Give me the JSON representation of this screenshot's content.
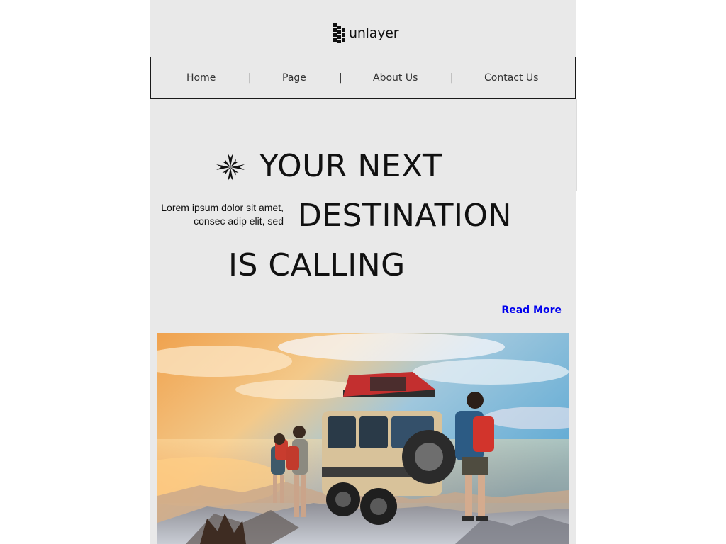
{
  "brand": {
    "name": "unlayer"
  },
  "nav": {
    "items": [
      {
        "label": "Home"
      },
      {
        "label": "Page"
      },
      {
        "label": "About Us"
      },
      {
        "label": "Contact Us"
      }
    ],
    "separator": "|"
  },
  "hero": {
    "line1": "YOUR NEXT",
    "line2": "DESTINATION",
    "line3": "IS CALLING",
    "side_text": "Lorem ipsum dolor sit amet, consec adip elit, sed",
    "cta_label": "Read More",
    "icon": "star-burst-icon"
  },
  "image": {
    "subject": "hero-photo"
  },
  "colors": {
    "background": "#e9e9e9",
    "text": "#111111",
    "link": "#0000ee"
  }
}
